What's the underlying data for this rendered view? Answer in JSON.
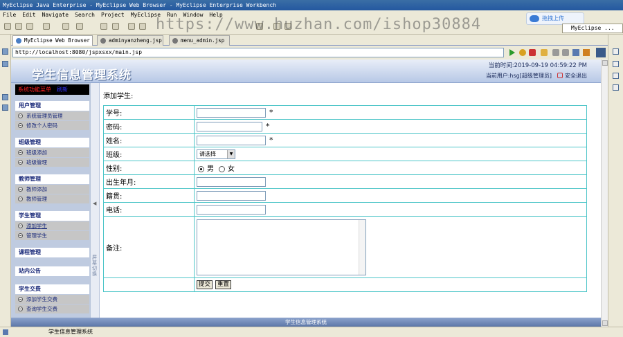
{
  "window": {
    "title": "MyEclipse Java Enterprise - MyEclipse Web Browser - MyEclipse Enterprise Workbench"
  },
  "menu": [
    "File",
    "Edit",
    "Navigate",
    "Search",
    "Project",
    "MyEclipse",
    "Run",
    "Window",
    "Help"
  ],
  "watermark": "https://www.huzhan.com/ishop30884",
  "upload_label": "拖拽上传",
  "perspective_label": "MyEclipse ...",
  "tabs": [
    {
      "label": "MyEclipse Web Browser",
      "close": "✕",
      "active": true
    },
    {
      "label": "adminyanzheng.jsp",
      "active": false
    },
    {
      "label": "menu_admin.jsp",
      "active": false
    }
  ],
  "url": "http://localhost:8080/jspxsxx/main.jsp",
  "header": {
    "site_title": "学生信息管理系统",
    "time_text": "当前时间:2019-09-19 04:59:22 PM",
    "user_text": "当前用户:hsg[超级管理员]",
    "logout": "安全退出"
  },
  "sidebar": {
    "head_red": "系统功能菜单",
    "head_blue": "刷新",
    "sections": [
      {
        "title": "用户管理",
        "items": [
          "系统管理员管理",
          "修改个人密码"
        ]
      },
      {
        "title": "班级管理",
        "items": [
          "班级添加",
          "班级管理"
        ]
      },
      {
        "title": "教师管理",
        "items": [
          "教师添加",
          "教师管理"
        ]
      },
      {
        "title": "学生管理",
        "items": [
          "添加学生",
          "管理学生"
        ]
      },
      {
        "title": "课程管理",
        "items": []
      },
      {
        "title": "站内公告",
        "items": []
      },
      {
        "title": "学生交费",
        "items": [
          "添加学生交费",
          "查询学生交费"
        ]
      }
    ]
  },
  "splitter_text": "屏幕切换",
  "form": {
    "heading": "添加学生:",
    "labels": {
      "xuehao": "学号:",
      "mima": "密码:",
      "xingming": "姓名:",
      "banji": "班级:",
      "xingbie": "性别:",
      "chusheng": "出生年月:",
      "jiguan": "籍贯:",
      "dianhua": "电话:",
      "beizhu": "备注:"
    },
    "required_mark": "*",
    "class_select": "请选择",
    "gender_options": [
      "男",
      "女"
    ],
    "gender_selected": "男",
    "submit": "提交",
    "reset": "重置"
  },
  "footer": "学生信息管理系统",
  "status": "学生信息管理系统"
}
